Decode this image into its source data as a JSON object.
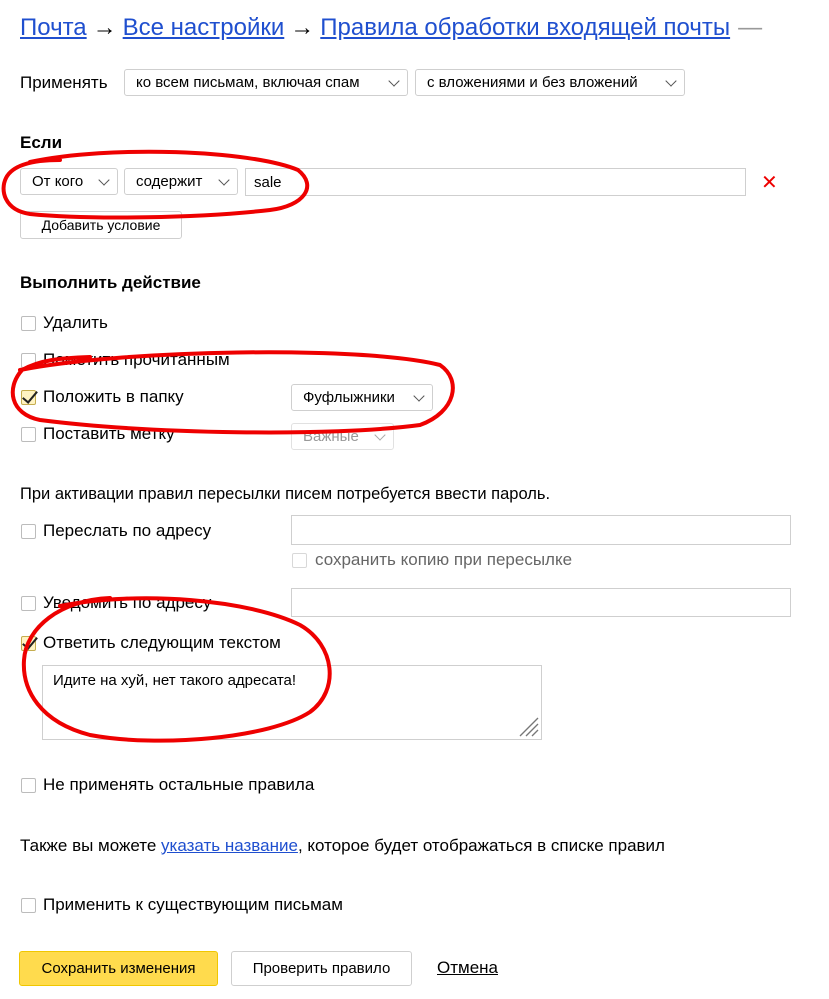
{
  "breadcrumb": {
    "mail": "Почта",
    "arrow": "→",
    "all_settings": "Все настройки",
    "rules": "Правила обработки входящей почты",
    "tail": "—"
  },
  "apply": {
    "label": "Применять",
    "scope": "ко всем письмам, включая спам",
    "attachments": "с вложениями и без вложений"
  },
  "conditions": {
    "heading": "Если",
    "field": "От кого",
    "operator": "содержит",
    "value": "sale",
    "remove_icon": "✕",
    "add_button": "Добавить условие"
  },
  "actions": {
    "heading": "Выполнить действие",
    "delete": "Удалить",
    "mark_read": "Пометить прочитанным",
    "move_to_folder": "Положить в папку",
    "folder": "Фуфлыжники",
    "set_label": "Поставить метку",
    "label_value": "Важные"
  },
  "forward": {
    "notice": "При активации правил пересылки писем потребуется ввести пароль.",
    "forward_to": "Переслать по адресу",
    "keep_copy": "сохранить копию при пересылке",
    "notify": "Уведомить по адресу",
    "reply": "Ответить следующим текстом",
    "reply_text": "Идите на хуй, нет такого адресата!"
  },
  "misc": {
    "no_other_rules": "Не применять остальные правила",
    "name_prefix": "Также вы можете ",
    "name_link": "указать название",
    "name_suffix": ", которое будет отображаться в списке правил",
    "apply_existing": "Применить к существующим письмам"
  },
  "footer": {
    "save": "Сохранить изменения",
    "check": "Проверить правило",
    "cancel": "Отмена"
  },
  "colors": {
    "annotation": "#ee0000",
    "primary_button": "#ffdb4d",
    "link": "#1f4fcf"
  }
}
